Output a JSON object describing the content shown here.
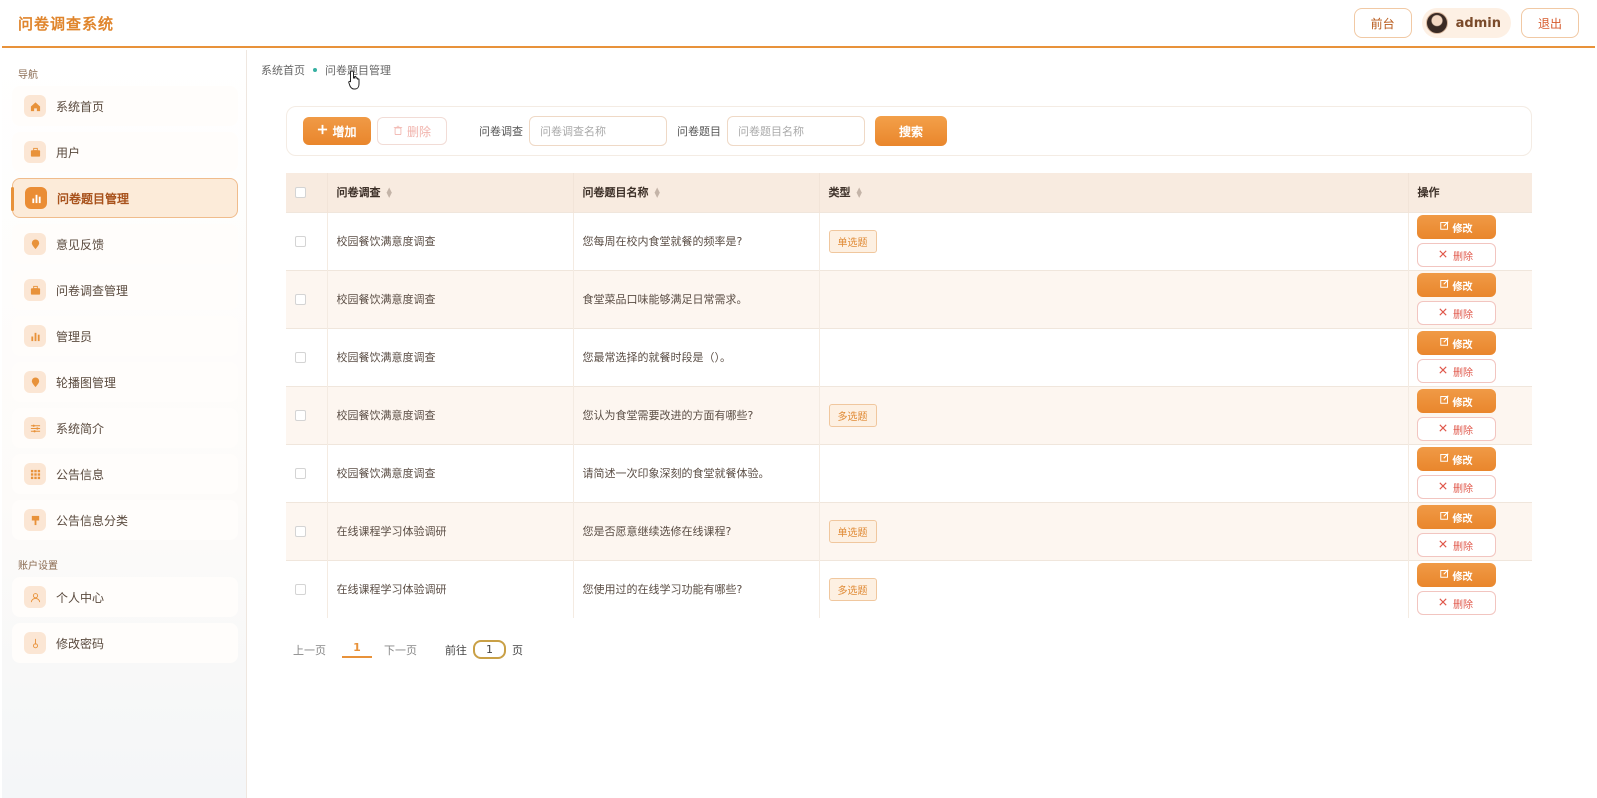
{
  "header": {
    "app_title": "问卷调查系统",
    "front_label": "前台",
    "username": "admin",
    "logout_label": "退出"
  },
  "sidebar": {
    "nav_section": "导航",
    "account_section": "账户设置",
    "items": [
      {
        "label": "系统首页",
        "icon": "home-icon",
        "active": false
      },
      {
        "label": "用户",
        "icon": "briefcase-icon",
        "active": false
      },
      {
        "label": "问卷题目管理",
        "icon": "bar-chart-icon",
        "active": true
      },
      {
        "label": "意见反馈",
        "icon": "location-pin-icon",
        "active": false
      },
      {
        "label": "问卷调查管理",
        "icon": "briefcase-icon",
        "active": false
      },
      {
        "label": "管理员",
        "icon": "bar-chart-icon",
        "active": false
      },
      {
        "label": "轮播图管理",
        "icon": "location-pin-icon",
        "active": false
      },
      {
        "label": "系统简介",
        "icon": "sliders-icon",
        "active": false
      },
      {
        "label": "公告信息",
        "icon": "grid-icon",
        "active": false
      },
      {
        "label": "公告信息分类",
        "icon": "brush-icon",
        "active": false
      }
    ],
    "account_items": [
      {
        "label": "个人中心",
        "icon": "user-icon"
      },
      {
        "label": "修改密码",
        "icon": "lock-icon"
      }
    ]
  },
  "breadcrumb": {
    "home": "系统首页",
    "current": "问卷题目管理"
  },
  "toolbar": {
    "add_label": "增加",
    "delete_label": "删除",
    "survey_label": "问卷调查",
    "survey_placeholder": "问卷调查名称",
    "question_label": "问卷题目",
    "question_placeholder": "问卷题目名称",
    "search_label": "搜索"
  },
  "table": {
    "headers": [
      "问卷调查",
      "问卷题目名称",
      "类型",
      "操作"
    ],
    "edit_label": "修改",
    "delete_label": "删除",
    "rows": [
      {
        "survey": "校园餐饮满意度调查",
        "question": "您每周在校内食堂就餐的频率是?",
        "type": "单选题"
      },
      {
        "survey": "校园餐饮满意度调查",
        "question": "食堂菜品口味能够满足日常需求。",
        "type": ""
      },
      {
        "survey": "校园餐饮满意度调查",
        "question": "您最常选择的就餐时段是（）。",
        "type": ""
      },
      {
        "survey": "校园餐饮满意度调查",
        "question": "您认为食堂需要改进的方面有哪些?",
        "type": "多选题"
      },
      {
        "survey": "校园餐饮满意度调查",
        "question": "请简述一次印象深刻的食堂就餐体验。",
        "type": ""
      },
      {
        "survey": "在线课程学习体验调研",
        "question": "您是否愿意继续选修在线课程?",
        "type": "单选题"
      },
      {
        "survey": "在线课程学习体验调研",
        "question": "您使用过的在线学习功能有哪些?",
        "type": "多选题"
      }
    ]
  },
  "pagination": {
    "prev": "上一页",
    "current_page": "1",
    "next": "下一页",
    "goto_label": "前往",
    "goto_value": "1",
    "page_unit": "页"
  },
  "colors": {
    "accent": "#e8923a",
    "brand_title": "#e0852c",
    "danger": "#e0574a"
  }
}
